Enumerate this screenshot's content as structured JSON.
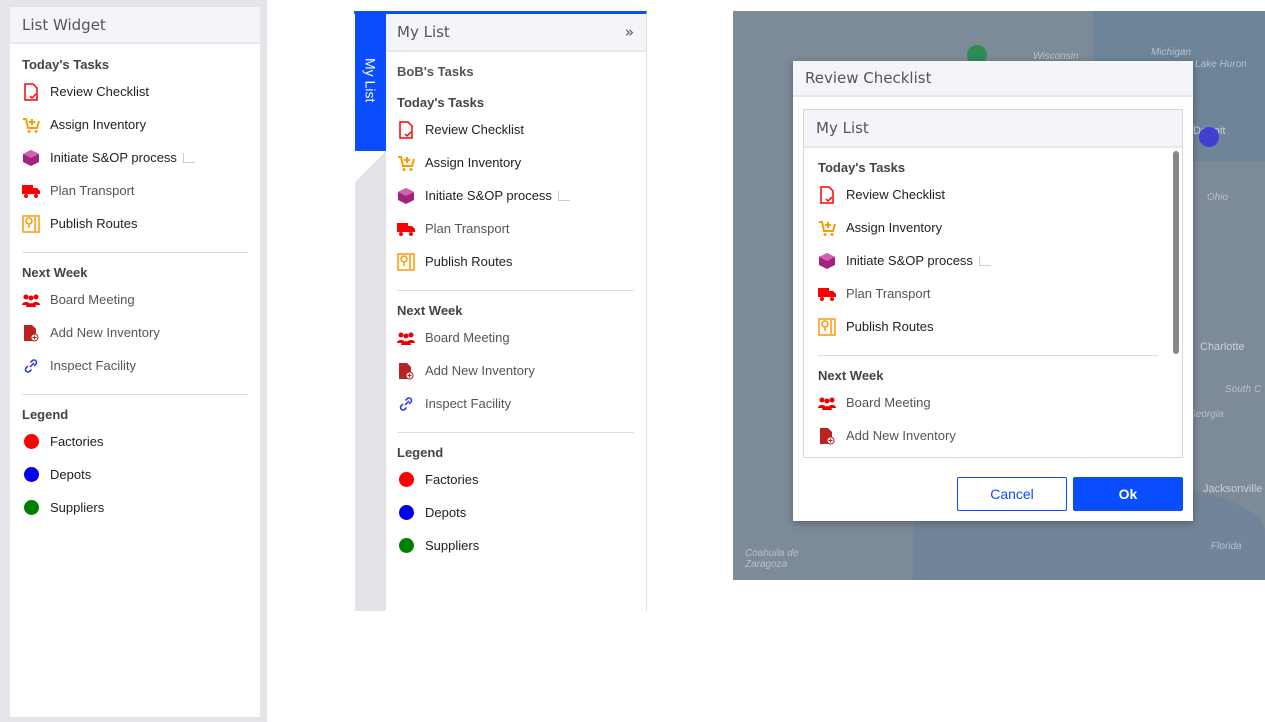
{
  "widget1": {
    "title": "List Widget"
  },
  "widget2": {
    "tab_label": "My List",
    "title": "My List",
    "collapse_icon": "»",
    "subtitle": "BoB's Tasks"
  },
  "modal": {
    "title": "Review Checklist",
    "inner_title": "My List",
    "cancel_label": "Cancel",
    "ok_label": "Ok"
  },
  "sections": {
    "today": {
      "title": "Today's Tasks",
      "items": [
        {
          "label": "Review Checklist",
          "icon": "checklist-icon"
        },
        {
          "label": "Assign Inventory",
          "icon": "cart-plus-icon"
        },
        {
          "label": "Initiate S&OP process",
          "icon": "cube-icon",
          "external": true
        },
        {
          "label": "Plan Transport",
          "icon": "truck-icon",
          "muted": true
        },
        {
          "label": "Publish Routes",
          "icon": "map-pin-icon"
        }
      ]
    },
    "next": {
      "title": "Next Week",
      "items": [
        {
          "label": "Board Meeting",
          "icon": "users-icon",
          "muted": true
        },
        {
          "label": "Add New Inventory",
          "icon": "file-add-icon",
          "muted": true
        },
        {
          "label": "Inspect Facility",
          "icon": "link-icon",
          "muted": true
        }
      ]
    },
    "legend": {
      "title": "Legend",
      "items": [
        {
          "label": "Factories",
          "color": "#ff0000"
        },
        {
          "label": "Depots",
          "color": "#0000ee"
        },
        {
          "label": "Suppliers",
          "color": "#008000"
        }
      ]
    }
  },
  "map": {
    "labels": [
      "Wisconsin",
      "Michigan",
      "Lake Huron",
      "Detroit",
      "Ohio",
      "Charlotte",
      "South C",
      "Georgia",
      "Jacksonville",
      "Florida",
      "Coahuila de Zaragoza"
    ],
    "markers": [
      {
        "type": "Suppliers",
        "color": "#2e8b57"
      },
      {
        "type": "Depots",
        "color": "#3333cc"
      }
    ]
  }
}
